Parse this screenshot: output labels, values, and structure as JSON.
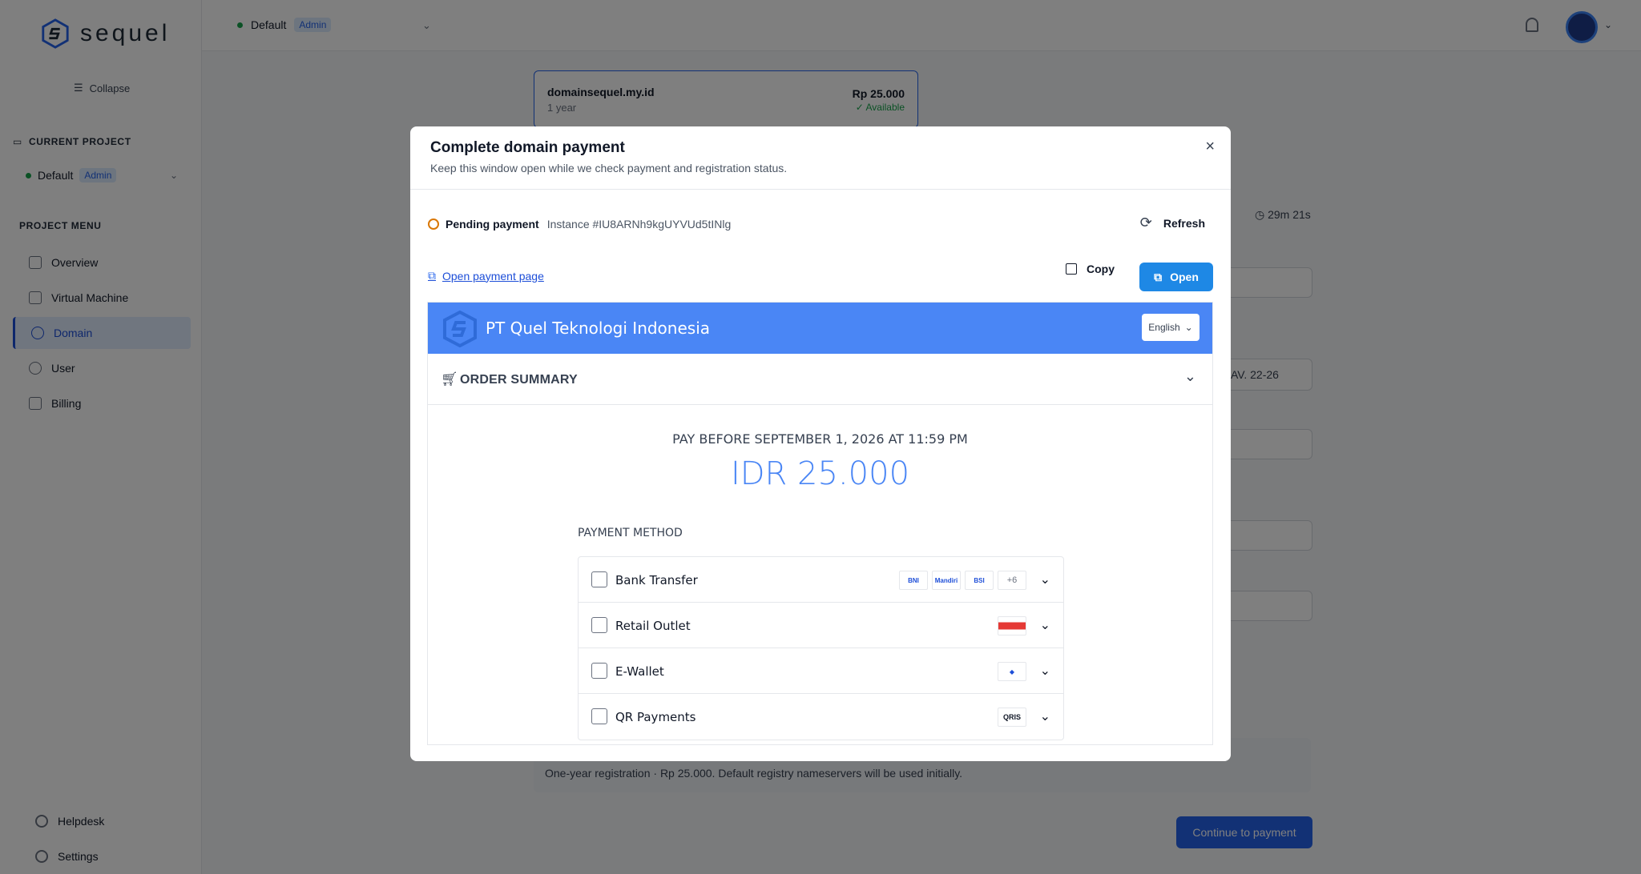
{
  "app": {
    "name": "sequel"
  },
  "sidebar": {
    "collapse_label": "Collapse",
    "current_project_title": "CURRENT PROJECT",
    "project_name": "Default",
    "project_role": "Admin",
    "menu_title": "PROJECT MENU",
    "items": [
      {
        "label": "Overview",
        "icon": "grid-icon"
      },
      {
        "label": "Virtual Machine",
        "icon": "server-icon"
      },
      {
        "label": "Domain",
        "icon": "globe-icon",
        "active": true
      },
      {
        "label": "User",
        "icon": "user-icon"
      },
      {
        "label": "Billing",
        "icon": "billing-icon"
      }
    ],
    "footer": [
      {
        "label": "Helpdesk",
        "icon": "help-icon"
      },
      {
        "label": "Settings",
        "icon": "gear-icon"
      }
    ]
  },
  "topbar": {
    "project_name": "Default",
    "project_role": "Admin"
  },
  "background": {
    "domain_card": {
      "name": "domainsequel.my.id",
      "term": "1 year",
      "price": "Rp 25.000",
      "status": "Available"
    },
    "timer": "29m 21s",
    "address_fragment": "AV. 22-26",
    "note": "One-year registration · Rp 25.000. Default registry nameservers will be used initially.",
    "continue_label": "Continue to payment"
  },
  "modal": {
    "title": "Complete domain payment",
    "subtitle": "Keep this window open while we check payment and registration status.",
    "status_label": "Pending payment",
    "instance": "Instance #IU8ARNh9kgUYVUd5tINlg",
    "refresh_label": "Refresh",
    "payment_link_label": "Open payment page",
    "copy_label": "Copy",
    "open_label": "Open",
    "checkout": {
      "merchant": "PT Quel Teknologi Indonesia",
      "language": "English",
      "order_summary_label": "ORDER SUMMARY",
      "pay_before": "PAY BEFORE SEPTEMBER 1, 2026 AT 11:59 PM",
      "amount": "IDR 25.000",
      "payment_method_label": "PAYMENT METHOD",
      "methods": [
        {
          "name": "Bank Transfer",
          "icon": "bank-icon",
          "logos": [
            "BNI",
            "Mandiri",
            "BSI"
          ],
          "more": "+6"
        },
        {
          "name": "Retail Outlet",
          "icon": "store-icon",
          "logos": [
            "Alfamart"
          ]
        },
        {
          "name": "E-Wallet",
          "icon": "phone-icon",
          "logos": [
            "DANA"
          ]
        },
        {
          "name": "QR Payments",
          "icon": "qr-icon",
          "logos": [
            "QRIS"
          ]
        }
      ]
    }
  },
  "colors": {
    "accent": "#1e88e5",
    "merchant_bar": "#4a86f5",
    "pending": "#d97706"
  }
}
